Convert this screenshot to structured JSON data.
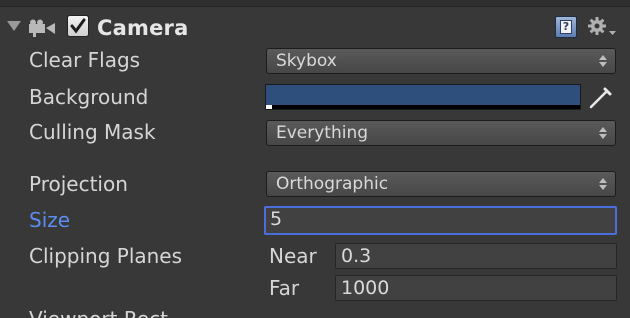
{
  "component": {
    "title": "Camera",
    "enabled": true,
    "icons": [
      "foldout-arrow-icon",
      "camera-icon",
      "checkbox-check-icon",
      "help-icon",
      "gear-icon"
    ],
    "help_glyph": "?"
  },
  "fields": {
    "clear_flags": {
      "label": "Clear Flags",
      "value": "Skybox"
    },
    "background": {
      "label": "Background",
      "color": "#2e4e7c"
    },
    "culling_mask": {
      "label": "Culling Mask",
      "value": "Everything"
    },
    "projection": {
      "label": "Projection",
      "value": "Orthographic"
    },
    "size": {
      "label": "Size",
      "value": "5"
    },
    "clipping_planes": {
      "label": "Clipping Planes",
      "near_label": "Near",
      "near_value": "0.3",
      "far_label": "Far",
      "far_value": "1000"
    },
    "next_partial": {
      "label": "Viewport Rect"
    }
  },
  "colors": {
    "panel_bg": "#383838",
    "focus_label": "#5b8df0",
    "focus_border": "#4a6fdc"
  }
}
